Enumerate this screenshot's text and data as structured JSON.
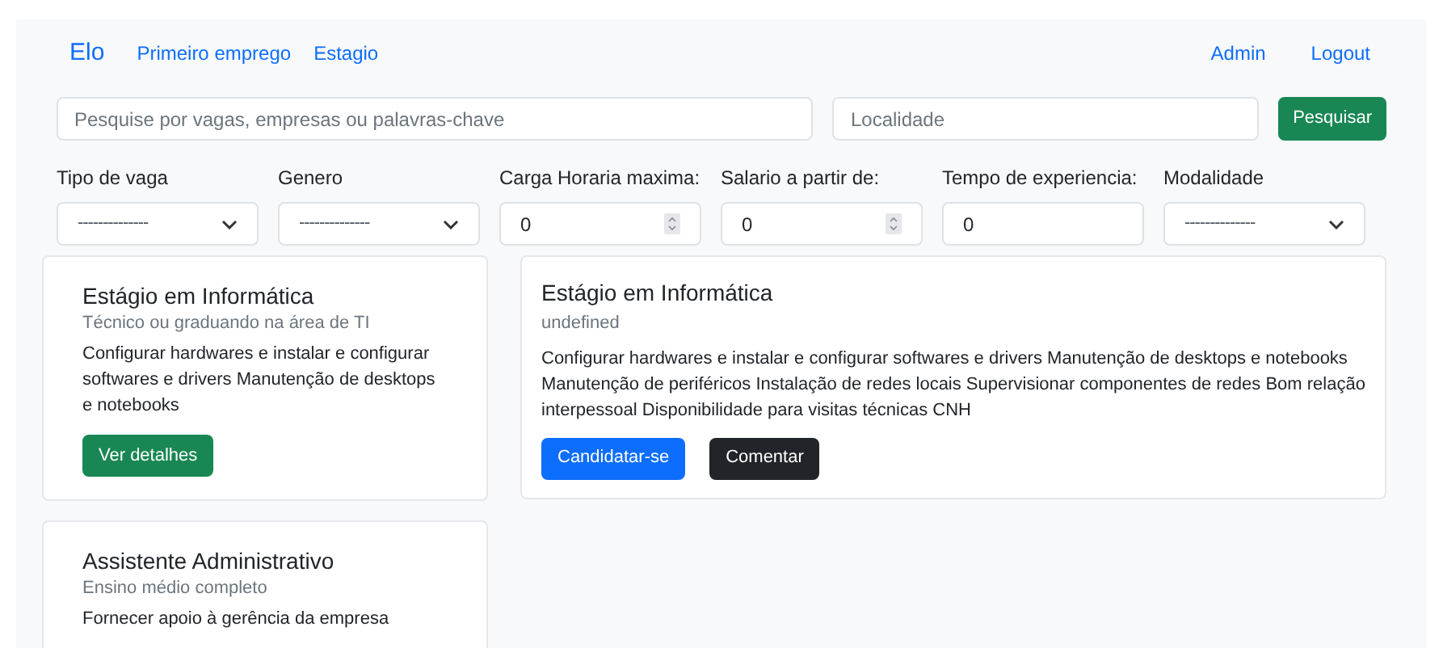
{
  "nav": {
    "brand": "Elo",
    "links": [
      "Primeiro emprego",
      "Estagio"
    ],
    "right_links": [
      "Admin",
      "Logout"
    ]
  },
  "search": {
    "placeholder": "Pesquise por vagas, empresas ou palavras-chave",
    "location_placeholder": "Localidade",
    "button": "Pesquisar"
  },
  "filters": [
    {
      "label": "Tipo de vaga",
      "kind": "select",
      "value": "--------------"
    },
    {
      "label": "Genero",
      "kind": "select",
      "value": "--------------"
    },
    {
      "label": "Carga Horaria maxima:",
      "kind": "number",
      "value": "0"
    },
    {
      "label": "Salario a partir de:",
      "kind": "number",
      "value": "0"
    },
    {
      "label": "Tempo de experiencia:",
      "kind": "text",
      "value": "0"
    },
    {
      "label": "Modalidade",
      "kind": "select",
      "value": "--------------"
    }
  ],
  "jobs": [
    {
      "title": "Estágio em Informática",
      "subtitle": "Técnico ou graduando na área de TI",
      "description": "Configurar hardwares e instalar e configurar softwares e drivers Manutenção de desktops e notebooks",
      "button": "Ver detalhes"
    },
    {
      "title": "Assistente Administrativo",
      "subtitle": "Ensino médio completo",
      "description": "Fornecer apoio à gerência da empresa"
    }
  ],
  "detail": {
    "title": "Estágio em Informática",
    "subtitle": "undefined",
    "description": "Configurar hardwares e instalar e configurar softwares e drivers Manutenção de desktops e notebooks Manutenção de periféricos Instalação de redes locais Supervisionar componentes de redes Bom relação interpessoal Disponibilidade para visitas técnicas CNH",
    "apply_button": "Candidatar-se",
    "comment_button": "Comentar"
  }
}
